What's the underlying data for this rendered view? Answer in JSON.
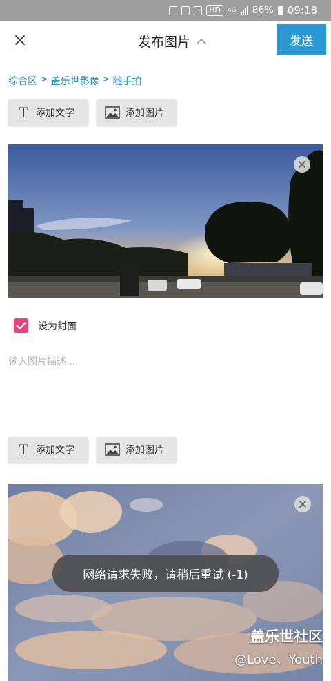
{
  "status_bar": {
    "network": "4G",
    "battery": "86%",
    "time": "09:18",
    "hd_label": "HD"
  },
  "header": {
    "title": "发布图片",
    "send_label": "发送"
  },
  "breadcrumb": {
    "parts": [
      "综合区",
      ">",
      "盖乐世影像",
      ">",
      "随手拍"
    ]
  },
  "toolbar": {
    "add_text_label": "添加文字",
    "add_image_label": "添加图片"
  },
  "editor": {
    "cover_checkbox": {
      "label": "设为封面",
      "checked": true
    },
    "description_placeholder": "输入图片描述..."
  },
  "toast": {
    "message": "网络请求失败，请稍后重试 (-1)"
  },
  "watermark": {
    "brand": "盖乐世社区",
    "user": "@Love、Youth"
  },
  "colors": {
    "accent": "#2b97d3",
    "checkbox": "#e3457f",
    "breadcrumb": "#2a8fb8"
  }
}
